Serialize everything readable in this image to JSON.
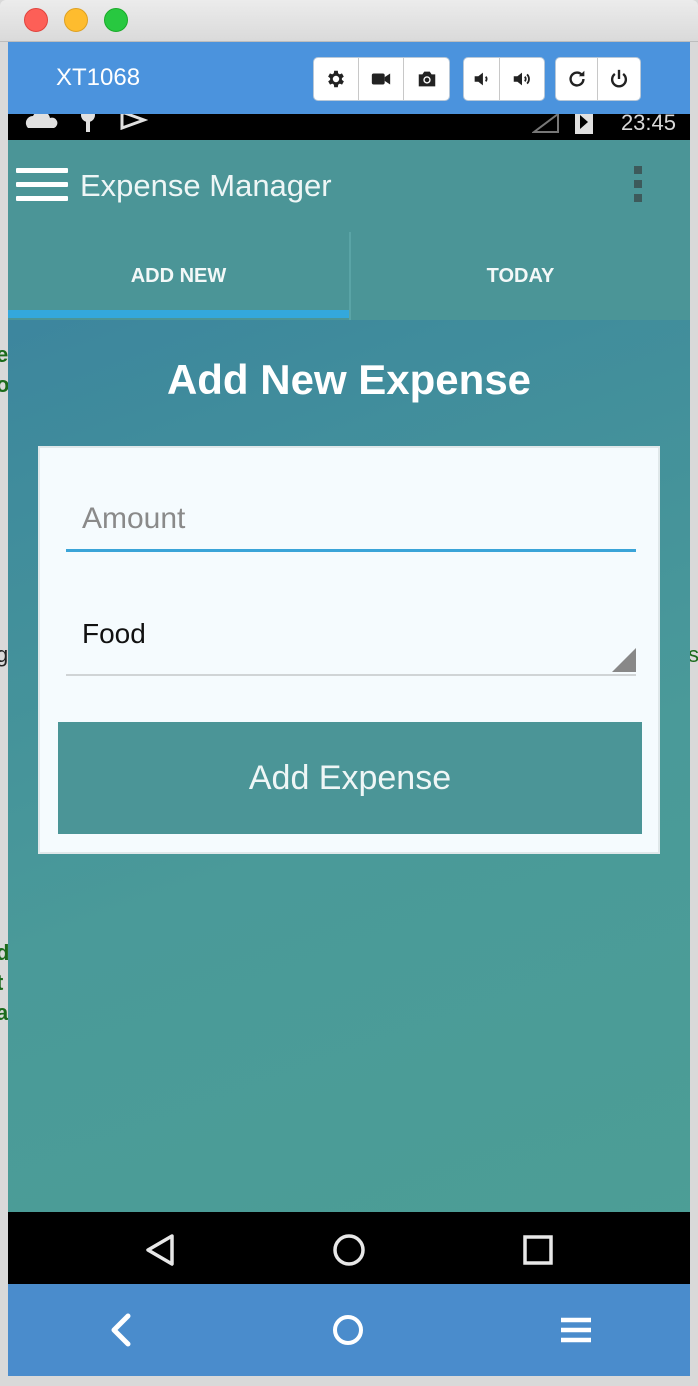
{
  "window": {
    "device_title": "XT1068"
  },
  "toolbar": {
    "buttons": [
      {
        "name": "settings",
        "icon": "gear-icon"
      },
      {
        "name": "screen-record",
        "icon": "video-camera-icon"
      },
      {
        "name": "screenshot",
        "icon": "camera-icon"
      },
      {
        "name": "volume-down",
        "icon": "volume-down-icon"
      },
      {
        "name": "volume-up",
        "icon": "volume-up-icon"
      },
      {
        "name": "rotate",
        "icon": "rotate-icon"
      },
      {
        "name": "power",
        "icon": "power-icon"
      }
    ]
  },
  "status_bar": {
    "time": "23:45"
  },
  "app_bar": {
    "title": "Expense Manager"
  },
  "tabs": [
    {
      "label": "ADD NEW",
      "selected": true
    },
    {
      "label": "TODAY",
      "selected": false
    }
  ],
  "form": {
    "heading": "Add New Expense",
    "amount_placeholder": "Amount",
    "amount_value": "",
    "category_selected": "Food",
    "submit_label": "Add Expense"
  },
  "colors": {
    "primary": "#4b9597",
    "tab_indicator": "#33a8dc",
    "input_underline": "#3aa4d8",
    "emulator_bar": "#4b93dd"
  }
}
